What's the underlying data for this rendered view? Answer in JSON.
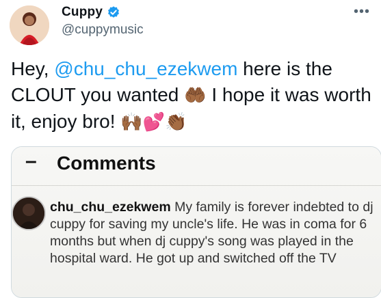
{
  "header": {
    "display_name": "Cuppy",
    "handle": "@cuppymusic",
    "more_label": "•••",
    "verified": true
  },
  "tweet": {
    "part1": "Hey, ",
    "mention": "@chu_chu_ezekwem",
    "part2": " here is the CLOUT you wanted ",
    "emoji1": "🤲🏾",
    "part3": " I hope it was worth it, enjoy bro! ",
    "emoji2": "🙌🏾",
    "emoji3": "💕",
    "emoji4": "👏🏾"
  },
  "card": {
    "back_icon": "–",
    "title": "Comments",
    "comment_user": "chu_chu_ezekwem",
    "comment_text": " My family is forever indebted to dj cuppy for saving my uncle's life. He was in coma for 6 months but when dj cuppy's song was played in the hospital ward. He got up and switched off the TV"
  },
  "colors": {
    "accent": "#1d9bf0",
    "text": "#0f1419",
    "secondary": "#536471",
    "border": "#cfd9de"
  }
}
